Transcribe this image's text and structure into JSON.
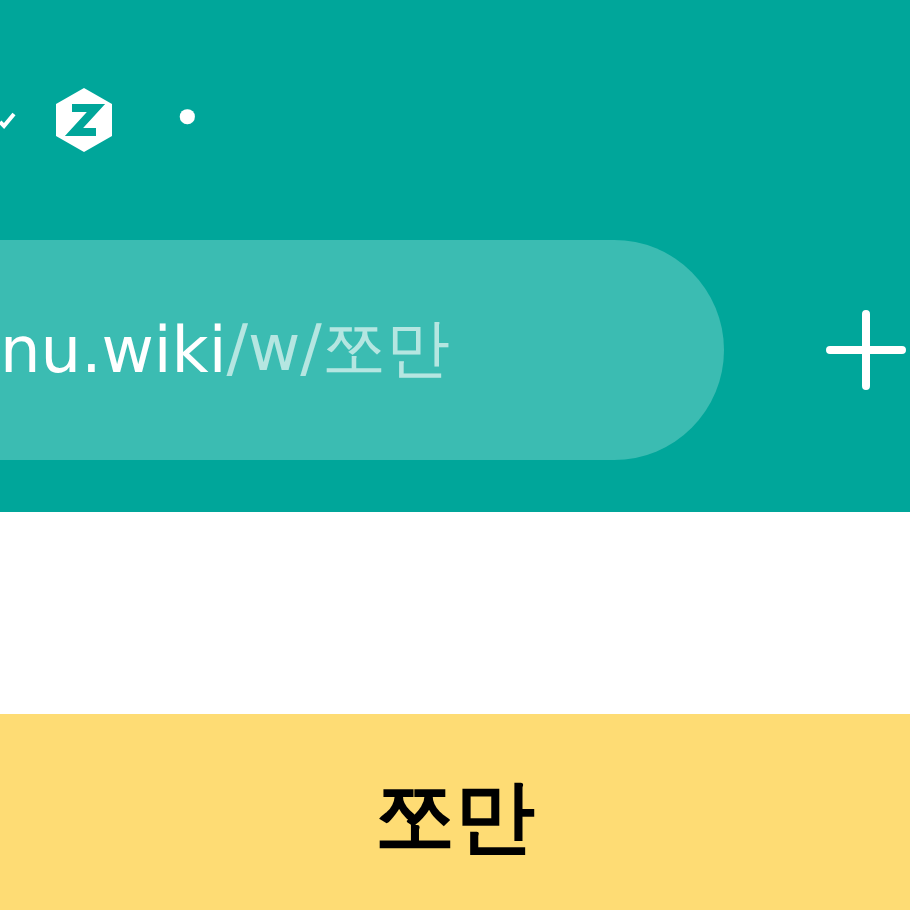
{
  "status_bar": {
    "dot": "•"
  },
  "address_bar": {
    "host": "nu.wiki",
    "path": "/w/쪼만"
  },
  "page": {
    "title": "쪼만"
  }
}
